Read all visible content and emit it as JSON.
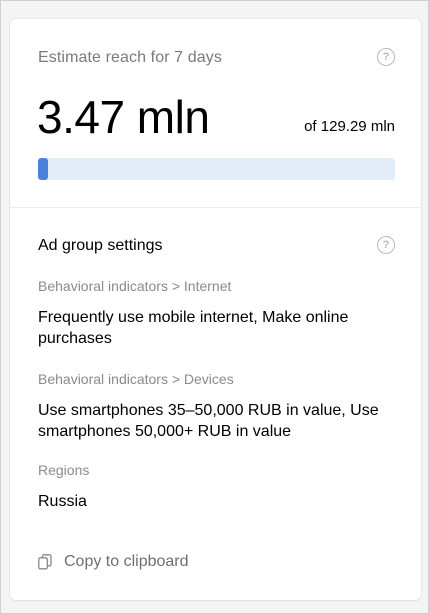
{
  "reach": {
    "title": "Estimate reach for 7 days",
    "value": "3.47 mln",
    "total": "of 129.29 mln",
    "progress_fraction": 0.027,
    "colors": {
      "bar_fill": "#4a82d9",
      "bar_track": "#e3edf9"
    },
    "help_icon": "question-circle-icon"
  },
  "settings": {
    "title": "Ad group settings",
    "help_icon": "question-circle-icon",
    "groups": [
      {
        "label": "Behavioral indicators > Internet",
        "value": "Frequently use mobile internet, Make online purchases"
      },
      {
        "label": "Behavioral indicators > Devices",
        "value": "Use smartphones 35–50,000 RUB in value, Use smartphones 50,000+ RUB in value"
      },
      {
        "label": "Regions",
        "value": "Russia"
      }
    ]
  },
  "copy": {
    "label": "Copy to clipboard",
    "icon": "copy-icon"
  }
}
